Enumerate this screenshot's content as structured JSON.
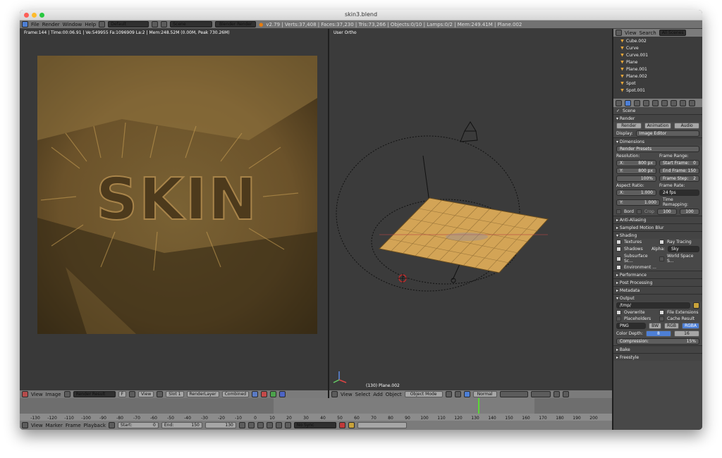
{
  "window": {
    "title": "skin3.blend"
  },
  "menu": {
    "items": [
      "File",
      "Render",
      "Window",
      "Help"
    ],
    "layout": "Default",
    "scene": "Scene",
    "engine": "Blender Render",
    "stats": "v2.79 | Verts:37,408 | Faces:37,230 | Tris:73,266 | Objects:0/10 | Lamps:0/2 | Mem:249.41M | Plane.002"
  },
  "render_view": {
    "info": "Frame:144 | Time:00:06.91 | Ve:549955 Fa:1096909 La:2 | Mem:248.52M (0.00M, Peak 730.26M)",
    "logo_text": "SKIN"
  },
  "image_header": {
    "view": "View",
    "image": "Image",
    "result": "Render Result",
    "f": "F",
    "view2": "View",
    "slot": "Slot 1",
    "layer": "RenderLayer",
    "pass": "Combined"
  },
  "viewport": {
    "label": "User Ortho",
    "selected": "(130) Plane.002",
    "menus": [
      "View",
      "Select",
      "Add",
      "Object"
    ],
    "mode": "Object Mode",
    "pivot": "Normal"
  },
  "outliner": {
    "tabs": [
      "View",
      "Search",
      "All Scenes"
    ],
    "items": [
      "Cube.002",
      "Curve",
      "Curve.001",
      "Plane",
      "Plane.001",
      "Plane.002",
      "Spot",
      "Spot.001"
    ]
  },
  "properties": {
    "scene_label": "Scene",
    "render_panel": {
      "title": "Render",
      "buttons": [
        "Render",
        "Animation",
        "Audio"
      ],
      "display_label": "Display:",
      "display_value": "Image Editor"
    },
    "dimensions": {
      "title": "Dimensions",
      "presets": "Render Presets",
      "resolution_label": "Resolution:",
      "frame_range_label": "Frame Range:",
      "x": "X:",
      "x_val": "800 px",
      "y": "Y:",
      "y_val": "800 px",
      "percent": "100%",
      "start": "Start Frame:",
      "start_val": "0",
      "end": "End Frame:",
      "end_val": "150",
      "step": "Frame Step:",
      "step_val": "2",
      "aspect_label": "Aspect Ratio:",
      "frame_rate_label": "Frame Rate:",
      "ax_val": "1.000",
      "ay_val": "1.000",
      "fps": "24 fps",
      "time_remap": "Time Remapping:",
      "old": "100",
      "new": "100",
      "bord": "Bord",
      "crop": "Crop"
    },
    "collapsed1": [
      "Anti-Aliasing",
      "Sampled Motion Blur"
    ],
    "shading": {
      "title": "Shading",
      "textures": "Textures",
      "ray_tracing": "Ray Tracing",
      "shadows": "Shadows",
      "alpha_label": "Alpha:",
      "alpha_val": "Sky",
      "sss": "Subsurface Sc...",
      "world_space": "World Space S...",
      "environment": "Environment ..."
    },
    "collapsed2": [
      "Performance",
      "Post Processing",
      "Metadata"
    ],
    "output": {
      "title": "Output",
      "path": "/tmp/",
      "overwrite": "Overwrite",
      "file_ext": "File Extensions",
      "placeholders": "Placeholders",
      "cache": "Cache Result",
      "format": "PNG",
      "bw": "BW",
      "rgb": "RGB",
      "rgba": "RGBA",
      "depth_label": "Color Depth:",
      "depth_8": "8",
      "depth_16": "16",
      "compression": "Compression:",
      "compression_val": "15%"
    },
    "collapsed3": [
      "Bake",
      "Freestyle"
    ]
  },
  "timeline": {
    "ticks": [
      "-130",
      "-120",
      "-110",
      "-100",
      "-90",
      "-80",
      "-70",
      "-60",
      "-50",
      "-40",
      "-30",
      "-20",
      "-10",
      "0",
      "10",
      "20",
      "30",
      "40",
      "50",
      "60",
      "70",
      "80",
      "90",
      "100",
      "110",
      "120",
      "130",
      "140",
      "150",
      "160",
      "170",
      "180",
      "190",
      "200"
    ],
    "menus": [
      "View",
      "Marker",
      "Frame",
      "Playback"
    ],
    "start_label": "Start:",
    "start": "0",
    "end_label": "End:",
    "end": "150",
    "current": "130",
    "sync": "No Sync"
  },
  "colors": {
    "accent": "#4d7fd6",
    "active_frame": "#5cd637",
    "model": "#d3a456",
    "render": "#7a5e2f"
  }
}
